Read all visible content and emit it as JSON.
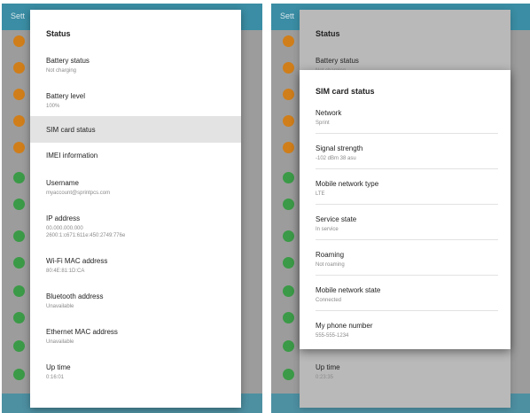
{
  "left": {
    "bg_title": "Sett",
    "dialog_title": "Status",
    "items": [
      {
        "title": "Battery status",
        "value": "Not charging"
      },
      {
        "title": "Battery level",
        "value": "100%"
      },
      {
        "title": "SIM card status",
        "value": ""
      },
      {
        "title": "IMEI information",
        "value": ""
      },
      {
        "title": "Username",
        "value": "myaccount@sprintpcs.com"
      },
      {
        "title": "IP address",
        "value": "00.000.000.000",
        "value2": "2600:1:c671:611e:450:2749:776e"
      },
      {
        "title": "Wi-Fi MAC address",
        "value": "80:4E:81:1D:CA"
      },
      {
        "title": "Bluetooth address",
        "value": "Unavailable"
      },
      {
        "title": "Ethernet MAC address",
        "value": "Unavailable"
      },
      {
        "title": "Up time",
        "value": "0:16:01"
      }
    ]
  },
  "right": {
    "bg_title": "Sett",
    "dialog_title": "Status",
    "bg_items": [
      {
        "title": "Battery status",
        "value": "Not charging"
      },
      {
        "title": "Up time",
        "value": "0:23:35"
      }
    ],
    "sim_title": "SIM card status",
    "sim_items": [
      {
        "title": "Network",
        "value": "Sprint"
      },
      {
        "title": "Signal strength",
        "value": "-102 dBm 38 asu"
      },
      {
        "title": "Mobile network type",
        "value": "LTE"
      },
      {
        "title": "Service state",
        "value": "In service"
      },
      {
        "title": "Roaming",
        "value": "Not roaming"
      },
      {
        "title": "Mobile network state",
        "value": "Connected"
      },
      {
        "title": "My phone number",
        "value": "555-555-1234"
      }
    ]
  },
  "colors": {
    "app_bar": "#3a8da4",
    "icon_orange": "#d07e1a",
    "icon_green": "#3b9a47",
    "highlight": "#e3e3e3"
  }
}
